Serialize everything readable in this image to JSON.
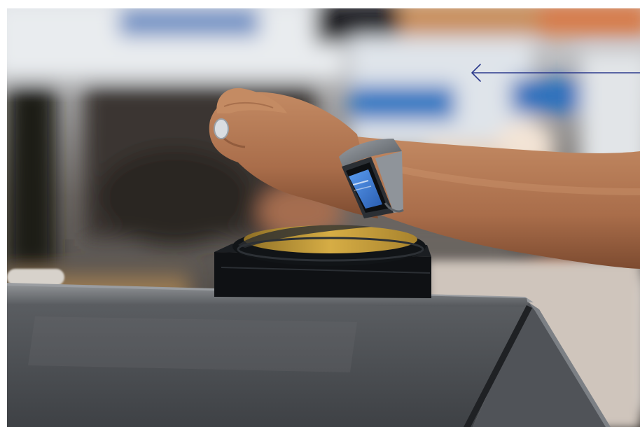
{
  "photo": {
    "subject": "watch-tap-payment",
    "colors": {
      "background_cool": "#9fb3c4",
      "background_warm": "#d9c7b2",
      "skin": "#b57a56",
      "skin_shadow": "#8c5638",
      "reader_body": "#111418",
      "reader_pad": "#c9a13c",
      "barrier_top": "#6d6f72",
      "barrier_face": "#4a4d51",
      "watch_band": "#7a7f86",
      "watch_screen": "#3f7fd6"
    }
  },
  "controls": {
    "back_arrow": {
      "icon": "arrow-left-icon",
      "color": "#2c3a8c"
    }
  }
}
